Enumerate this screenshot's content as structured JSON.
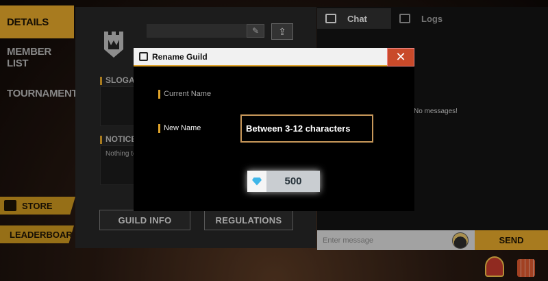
{
  "nav": {
    "details": "DETAILS",
    "member_list": "MEMBER LIST",
    "tournament": "TOURNAMENT",
    "store": "STORE",
    "leaderboard": "LEADERBOARD"
  },
  "center": {
    "slogan_label": "SLOGAN",
    "notice_label": "NOTICE",
    "notice_text": "Nothing to",
    "guild_info_button": "GUILD INFO",
    "regulations_button": "REGULATIONS"
  },
  "chat": {
    "tabs": [
      "Chat",
      "Logs"
    ],
    "empty_text": "No messages!",
    "input_placeholder": "Enter message",
    "send_button": "SEND"
  },
  "modal": {
    "title": "Rename Guild",
    "close_glyph": "✕",
    "current_name_label": "Current Name",
    "new_name_label": "New Name",
    "new_name_placeholder": "Between 3-12 characters",
    "cost": "500",
    "currency_icon": "diamond-icon"
  },
  "colors": {
    "accent": "#e0a42a",
    "close": "#c94a2a",
    "diamond": "#3fb6e8"
  }
}
